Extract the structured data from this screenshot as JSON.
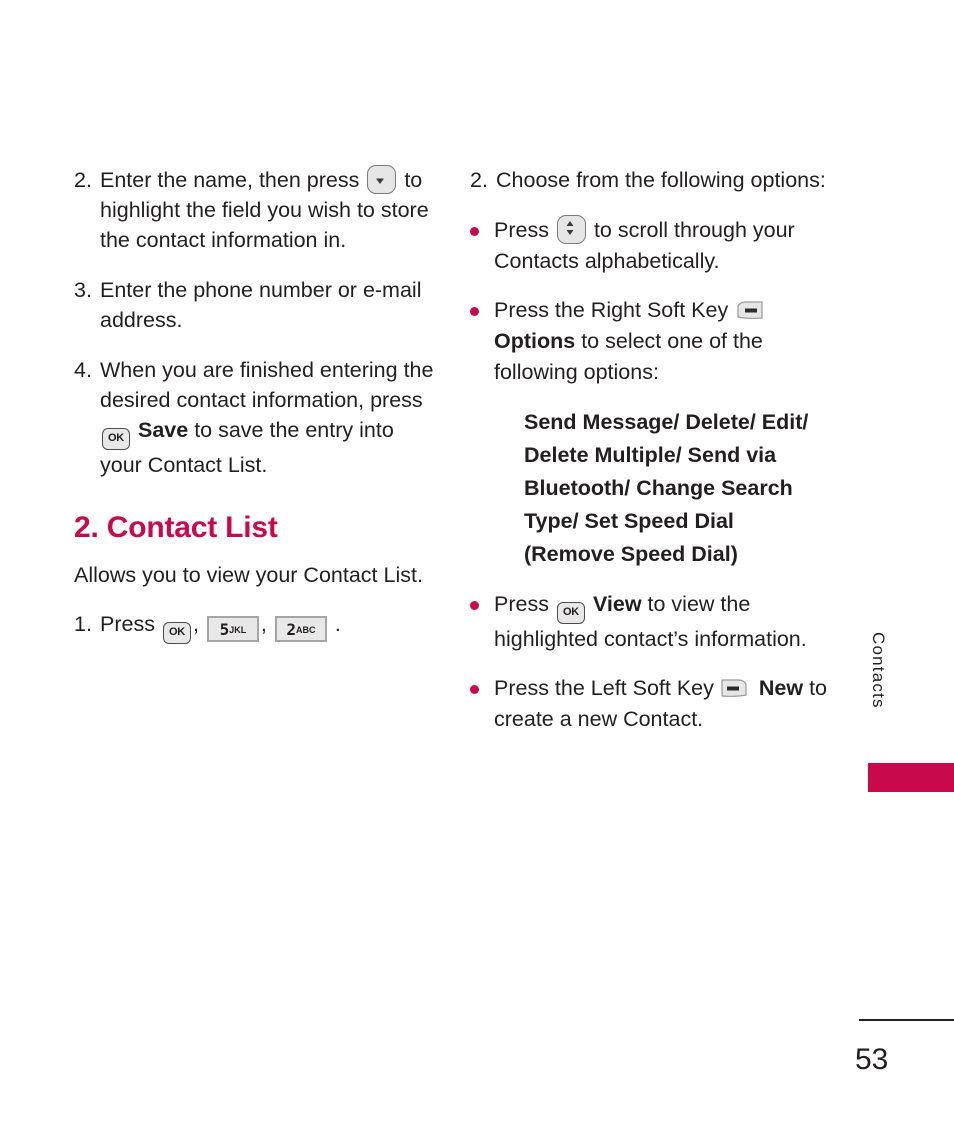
{
  "page": {
    "number": "53",
    "side_tab": "Contacts",
    "accent_color": "#C8094C",
    "text_color": "#231F20"
  },
  "left_column": {
    "steps": [
      {
        "number": "2.",
        "text_before_icon": "Enter the name, then press",
        "icon": "down-arrow-key-icon",
        "text_after_icon": "to highlight the field you wish to store the contact information in."
      },
      {
        "number": "3.",
        "text": "Enter the phone number or e-mail address."
      },
      {
        "number": "4.",
        "text_before_icon": "When you are finished entering the desired contact information, press",
        "icon": "ok-key-icon",
        "bold_label": "Save",
        "text_after_icon": "to save the entry into your Contact List."
      }
    ],
    "section": {
      "heading": "2. Contact List",
      "description": "Allows you to view your Contact List.",
      "step": {
        "number": "1.",
        "press_label": "Press",
        "keys": [
          {
            "icon": "ok-key-icon",
            "digit": "OK",
            "letters": ""
          },
          {
            "icon": "keypad-5-key-icon",
            "digit": "5",
            "letters": "JKL"
          },
          {
            "icon": "keypad-2-key-icon",
            "digit": "2",
            "letters": "ABC"
          }
        ],
        "separator": ",",
        "terminator": "."
      }
    }
  },
  "right_column": {
    "step": {
      "number": "2.",
      "text": "Choose from the following options:"
    },
    "bullets": [
      {
        "text_before_icon": "Press",
        "icon": "scroll-up-down-key-icon",
        "text_after_icon": "to scroll through your Contacts alphabetically."
      },
      {
        "text_before_icon": "Press the Right Soft Key",
        "icon": "right-soft-key-icon",
        "bold_label": "Options",
        "text_after_icon": "to select one of the following options:"
      },
      {
        "text_before_icon": "Press",
        "icon": "ok-key-icon",
        "bold_label": "View",
        "text_after_icon": "to view the highlighted contact’s information."
      },
      {
        "text_before_icon": "Press the Left Soft Key",
        "icon": "left-soft-key-icon",
        "bold_label": "New",
        "text_after_icon": "to create a new Contact."
      }
    ],
    "options_list": "Send Message/ Delete/ Edit/ Delete Multiple/ Send via Bluetooth/ Change Search Type/ Set Speed Dial (Remove Speed Dial)"
  }
}
